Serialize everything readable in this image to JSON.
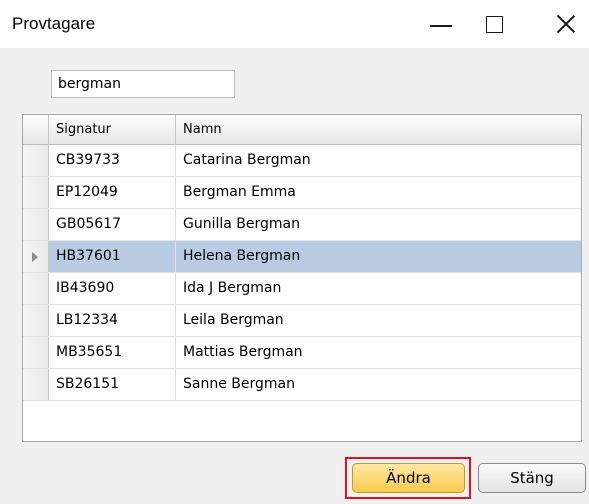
{
  "window": {
    "title": "Provtagare"
  },
  "search": {
    "value": "bergman"
  },
  "grid": {
    "columns": [
      "Signatur",
      "Namn"
    ],
    "rows": [
      {
        "signatur": "CB39733",
        "namn": "Catarina Bergman"
      },
      {
        "signatur": "EP12049",
        "namn": "Bergman Emma"
      },
      {
        "signatur": "GB05617",
        "namn": "Gunilla Bergman"
      },
      {
        "signatur": "HB37601",
        "namn": "Helena Bergman"
      },
      {
        "signatur": "IB43690",
        "namn": "Ida J Bergman"
      },
      {
        "signatur": "LB12334",
        "namn": "Leila Bergman"
      },
      {
        "signatur": "MB35651",
        "namn": "Mattias Bergman"
      },
      {
        "signatur": "SB26151",
        "namn": "Sanne Bergman"
      }
    ],
    "selected_index": 3
  },
  "buttons": {
    "andra_label": "Ändra",
    "stang_label": "Stäng"
  },
  "colors": {
    "selected_row": "#b8cbe3",
    "andra_button": "#f7c94a",
    "highlight_frame": "#e0101f"
  }
}
